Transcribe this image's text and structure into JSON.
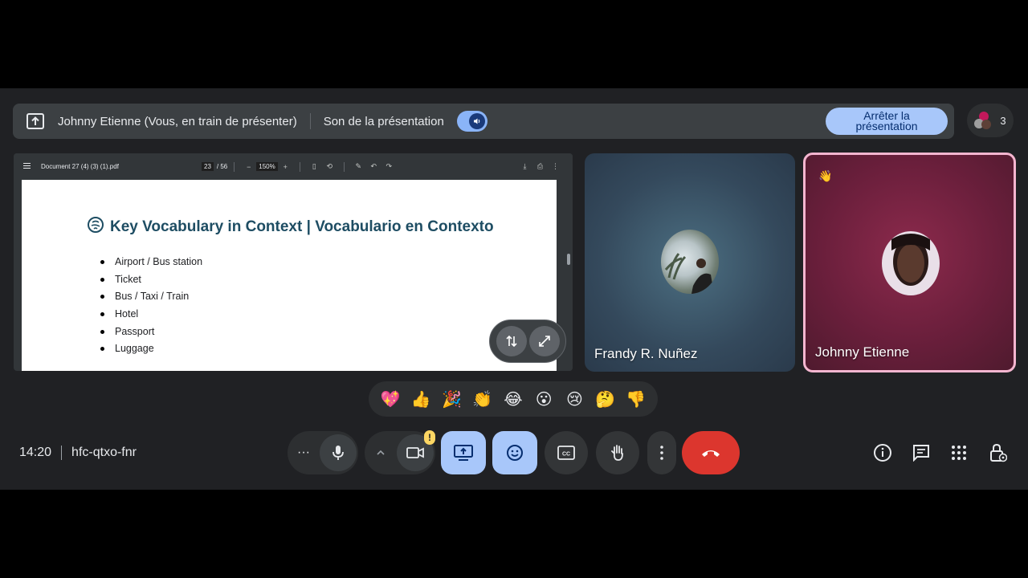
{
  "banner": {
    "presenter_text": "Johnny Etienne (Vous, en train de présenter)",
    "audio_label": "Son de la présentation",
    "stop_label": "Arrêter la présentation",
    "participant_count": "3"
  },
  "pdf": {
    "filename": "Document 27 (4) (3) (1).pdf",
    "page_current": "23",
    "page_total": "/ 56",
    "zoom": "150%",
    "slide_title": "Key Vocabulary in Context | Vocabulario en Contexto",
    "vocab": [
      "Airport / Bus station",
      "Ticket",
      "Bus / Taxi / Train",
      "Hotel",
      "Passport",
      "Luggage"
    ]
  },
  "participants": [
    {
      "name": "Frandy R. Nuñez"
    },
    {
      "name": "Johnny Etienne"
    }
  ],
  "reactions": [
    "💖",
    "👍",
    "🎉",
    "👏",
    "😂",
    "😮",
    "😢",
    "🤔",
    "👎"
  ],
  "meeting": {
    "time": "14:20",
    "code": "hfc-qtxo-fnr"
  },
  "colors": {
    "accent_blue": "#a8c7fa",
    "end_call_red": "#dc362e",
    "active_speaker_border": "#f5b6d0"
  }
}
